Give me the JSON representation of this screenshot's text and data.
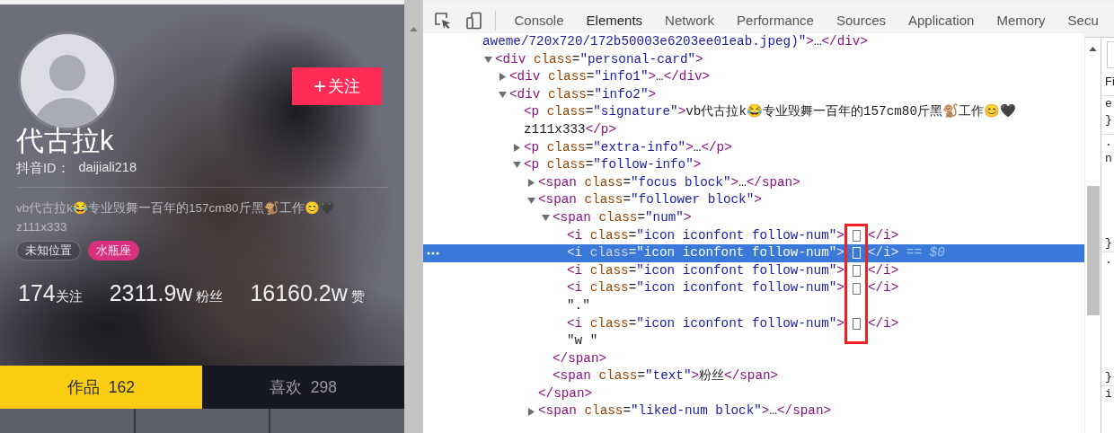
{
  "page": {
    "follow_button": {
      "icon": "+",
      "label": "关注"
    },
    "nickname": "代古拉k",
    "id_label": "抖音ID：",
    "id_value": "daijiali218",
    "signature_lines": [
      "vb代古拉k😂专业毁舞一百年的157cm80斤黑🐒工作😊🖤",
      "z111x333"
    ],
    "tags": [
      {
        "label": "未知位置",
        "kind": "outline"
      },
      {
        "label": "水瓶座",
        "kind": "filled"
      }
    ],
    "stats": [
      {
        "value": "174",
        "label": "关注"
      },
      {
        "value": "2311.9w",
        "label": "粉丝"
      },
      {
        "value": "16160.2w",
        "label": "赞"
      }
    ],
    "tabs": [
      {
        "label": "作品",
        "count": "162",
        "selected": true
      },
      {
        "label": "喜欢",
        "count": "298",
        "selected": false
      }
    ]
  },
  "devtools": {
    "tabs": [
      {
        "label": "Console",
        "selected": false
      },
      {
        "label": "Elements",
        "selected": true
      },
      {
        "label": "Network",
        "selected": false
      },
      {
        "label": "Performance",
        "selected": false
      },
      {
        "label": "Sources",
        "selected": false
      },
      {
        "label": "Application",
        "selected": false
      },
      {
        "label": "Memory",
        "selected": false
      },
      {
        "label": "Secu",
        "selected": false
      }
    ],
    "dom_tree": [
      {
        "kind": "continuation",
        "selected": false,
        "open": [
          {
            "kind": "val",
            "text": "aweme/720x720/172b50003e6203ee01eab.jpeg)\""
          },
          {
            "kind": "tag",
            "text": ">"
          },
          {
            "kind": "text",
            "text": "…"
          },
          {
            "kind": "tag",
            "text": "</div>"
          }
        ]
      },
      {
        "kind": "branch",
        "expanded": true,
        "selected": false,
        "open": [
          {
            "kind": "tag",
            "text": "<div"
          },
          {
            "kind": "attr",
            "text": " class"
          },
          {
            "kind": "text",
            "text": "="
          },
          {
            "kind": "val",
            "text": "\"personal-card\""
          },
          {
            "kind": "tag",
            "text": ">"
          }
        ],
        "children": [
          {
            "kind": "branch",
            "expanded": false,
            "selected": false,
            "open": [
              {
                "kind": "tag",
                "text": "<div"
              },
              {
                "kind": "attr",
                "text": " class"
              },
              {
                "kind": "text",
                "text": "="
              },
              {
                "kind": "val",
                "text": "\"info1\""
              },
              {
                "kind": "tag",
                "text": ">"
              },
              {
                "kind": "text",
                "text": "…"
              },
              {
                "kind": "tag",
                "text": "</div>"
              }
            ]
          },
          {
            "kind": "branch",
            "expanded": true,
            "selected": false,
            "open": [
              {
                "kind": "tag",
                "text": "<div"
              },
              {
                "kind": "attr",
                "text": " class"
              },
              {
                "kind": "text",
                "text": "="
              },
              {
                "kind": "val",
                "text": "\"info2\""
              },
              {
                "kind": "tag",
                "text": ">"
              }
            ],
            "children": [
              {
                "kind": "leaf",
                "selected": false,
                "open": [
                  {
                    "kind": "tag",
                    "text": "<p"
                  },
                  {
                    "kind": "attr",
                    "text": " class"
                  },
                  {
                    "kind": "text",
                    "text": "="
                  },
                  {
                    "kind": "val",
                    "text": "\"signature\""
                  },
                  {
                    "kind": "tag",
                    "text": ">"
                  },
                  {
                    "kind": "text",
                    "text": "vb代古拉k😂专业毁舞一百年的157cm80斤黑🐒工作😊🖤"
                  }
                ],
                "continued": [
                  {
                    "kind": "text",
                    "text": "z111x333"
                  },
                  {
                    "kind": "tag",
                    "text": "</p>"
                  }
                ]
              },
              {
                "kind": "branch",
                "expanded": false,
                "selected": false,
                "open": [
                  {
                    "kind": "tag",
                    "text": "<p"
                  },
                  {
                    "kind": "attr",
                    "text": " class"
                  },
                  {
                    "kind": "text",
                    "text": "="
                  },
                  {
                    "kind": "val",
                    "text": "\"extra-info\""
                  },
                  {
                    "kind": "tag",
                    "text": ">"
                  },
                  {
                    "kind": "text",
                    "text": "…"
                  },
                  {
                    "kind": "tag",
                    "text": "</p>"
                  }
                ]
              },
              {
                "kind": "branch",
                "expanded": true,
                "selected": false,
                "open": [
                  {
                    "kind": "tag",
                    "text": "<p"
                  },
                  {
                    "kind": "attr",
                    "text": " class"
                  },
                  {
                    "kind": "text",
                    "text": "="
                  },
                  {
                    "kind": "val",
                    "text": "\"follow-info\""
                  },
                  {
                    "kind": "tag",
                    "text": ">"
                  }
                ],
                "children": [
                  {
                    "kind": "branch",
                    "expanded": false,
                    "selected": false,
                    "open": [
                      {
                        "kind": "tag",
                        "text": "<span"
                      },
                      {
                        "kind": "attr",
                        "text": " class"
                      },
                      {
                        "kind": "text",
                        "text": "="
                      },
                      {
                        "kind": "val",
                        "text": "\"focus block\""
                      },
                      {
                        "kind": "tag",
                        "text": ">"
                      },
                      {
                        "kind": "text",
                        "text": "…"
                      },
                      {
                        "kind": "tag",
                        "text": "</span>"
                      }
                    ]
                  },
                  {
                    "kind": "branch",
                    "expanded": true,
                    "selected": false,
                    "open": [
                      {
                        "kind": "tag",
                        "text": "<span"
                      },
                      {
                        "kind": "attr",
                        "text": " class"
                      },
                      {
                        "kind": "text",
                        "text": "="
                      },
                      {
                        "kind": "val",
                        "text": "\"follower block\""
                      },
                      {
                        "kind": "tag",
                        "text": ">"
                      }
                    ],
                    "children": [
                      {
                        "kind": "branch",
                        "expanded": true,
                        "selected": false,
                        "open": [
                          {
                            "kind": "tag",
                            "text": "<span"
                          },
                          {
                            "kind": "attr",
                            "text": " class"
                          },
                          {
                            "kind": "text",
                            "text": "="
                          },
                          {
                            "kind": "val",
                            "text": "\"num\""
                          },
                          {
                            "kind": "tag",
                            "text": ">"
                          }
                        ],
                        "children": [
                          {
                            "kind": "leaf",
                            "selected": false,
                            "open": [
                              {
                                "kind": "tag",
                                "text": "<i"
                              },
                              {
                                "kind": "attr",
                                "text": " class"
                              },
                              {
                                "kind": "text",
                                "text": "="
                              },
                              {
                                "kind": "val",
                                "text": "\"icon iconfont follow-num\""
                              },
                              {
                                "kind": "tag",
                                "text": ">"
                              },
                              {
                                "kind": "glyph"
                              },
                              {
                                "kind": "tag",
                                "text": "</i>"
                              }
                            ]
                          },
                          {
                            "kind": "leaf",
                            "selected": true,
                            "open": [
                              {
                                "kind": "tag",
                                "text": "<i"
                              },
                              {
                                "kind": "attr",
                                "text": " class"
                              },
                              {
                                "kind": "text",
                                "text": "="
                              },
                              {
                                "kind": "val",
                                "text": "\"icon iconfont follow-num\""
                              },
                              {
                                "kind": "tag",
                                "text": ">"
                              },
                              {
                                "kind": "glyph"
                              },
                              {
                                "kind": "tag",
                                "text": "</i>"
                              },
                              {
                                "kind": "note",
                                "text": " == $0"
                              }
                            ]
                          },
                          {
                            "kind": "leaf",
                            "selected": false,
                            "open": [
                              {
                                "kind": "tag",
                                "text": "<i"
                              },
                              {
                                "kind": "attr",
                                "text": " class"
                              },
                              {
                                "kind": "text",
                                "text": "="
                              },
                              {
                                "kind": "val",
                                "text": "\"icon iconfont follow-num\""
                              },
                              {
                                "kind": "tag",
                                "text": ">"
                              },
                              {
                                "kind": "glyph"
                              },
                              {
                                "kind": "tag",
                                "text": "</i>"
                              }
                            ]
                          },
                          {
                            "kind": "leaf",
                            "selected": false,
                            "open": [
                              {
                                "kind": "tag",
                                "text": "<i"
                              },
                              {
                                "kind": "attr",
                                "text": " class"
                              },
                              {
                                "kind": "text",
                                "text": "="
                              },
                              {
                                "kind": "val",
                                "text": "\"icon iconfont follow-num\""
                              },
                              {
                                "kind": "tag",
                                "text": ">"
                              },
                              {
                                "kind": "glyph"
                              },
                              {
                                "kind": "tag",
                                "text": "</i>"
                              }
                            ]
                          },
                          {
                            "kind": "leaf",
                            "selected": false,
                            "open": [
                              {
                                "kind": "text",
                                "text": "\".\""
                              }
                            ]
                          },
                          {
                            "kind": "leaf",
                            "selected": false,
                            "open": [
                              {
                                "kind": "tag",
                                "text": "<i"
                              },
                              {
                                "kind": "attr",
                                "text": " class"
                              },
                              {
                                "kind": "text",
                                "text": "="
                              },
                              {
                                "kind": "val",
                                "text": "\"icon iconfont follow-num\""
                              },
                              {
                                "kind": "tag",
                                "text": ">"
                              },
                              {
                                "kind": "glyph"
                              },
                              {
                                "kind": "tag",
                                "text": "</i>"
                              }
                            ]
                          },
                          {
                            "kind": "leaf",
                            "selected": false,
                            "open": [
                              {
                                "kind": "text",
                                "text": "\"w \""
                              }
                            ]
                          }
                        ],
                        "close": [
                          {
                            "kind": "tag",
                            "text": "</span>"
                          }
                        ]
                      },
                      {
                        "kind": "leaf",
                        "selected": false,
                        "open": [
                          {
                            "kind": "tag",
                            "text": "<span"
                          },
                          {
                            "kind": "attr",
                            "text": " class"
                          },
                          {
                            "kind": "text",
                            "text": "="
                          },
                          {
                            "kind": "val",
                            "text": "\"text\""
                          },
                          {
                            "kind": "tag",
                            "text": ">"
                          },
                          {
                            "kind": "text",
                            "text": "粉丝"
                          },
                          {
                            "kind": "tag",
                            "text": "</span>"
                          }
                        ]
                      }
                    ],
                    "close": [
                      {
                        "kind": "tag",
                        "text": "</span>"
                      }
                    ]
                  },
                  {
                    "kind": "branch",
                    "expanded": false,
                    "selected": false,
                    "open": [
                      {
                        "kind": "tag",
                        "text": "<span"
                      },
                      {
                        "kind": "attr",
                        "text": " class"
                      },
                      {
                        "kind": "text",
                        "text": "="
                      },
                      {
                        "kind": "val",
                        "text": "\"liked-num block\""
                      },
                      {
                        "kind": "tag",
                        "text": ">"
                      },
                      {
                        "kind": "text",
                        "text": "…"
                      },
                      {
                        "kind": "tag",
                        "text": "</span>"
                      }
                    ]
                  }
                ]
              }
            ]
          }
        ]
      }
    ],
    "styles_pane": {
      "rules": [
        {
          "lines": [
            "Fi"
          ]
        },
        {
          "lines": [
            "e",
            "}"
          ]
        },
        {
          "lines": [
            ".",
            "n",
            "}"
          ]
        },
        {
          "lines": [
            ".",
            "}"
          ]
        },
        {
          "lines": [
            "i"
          ]
        }
      ]
    }
  }
}
